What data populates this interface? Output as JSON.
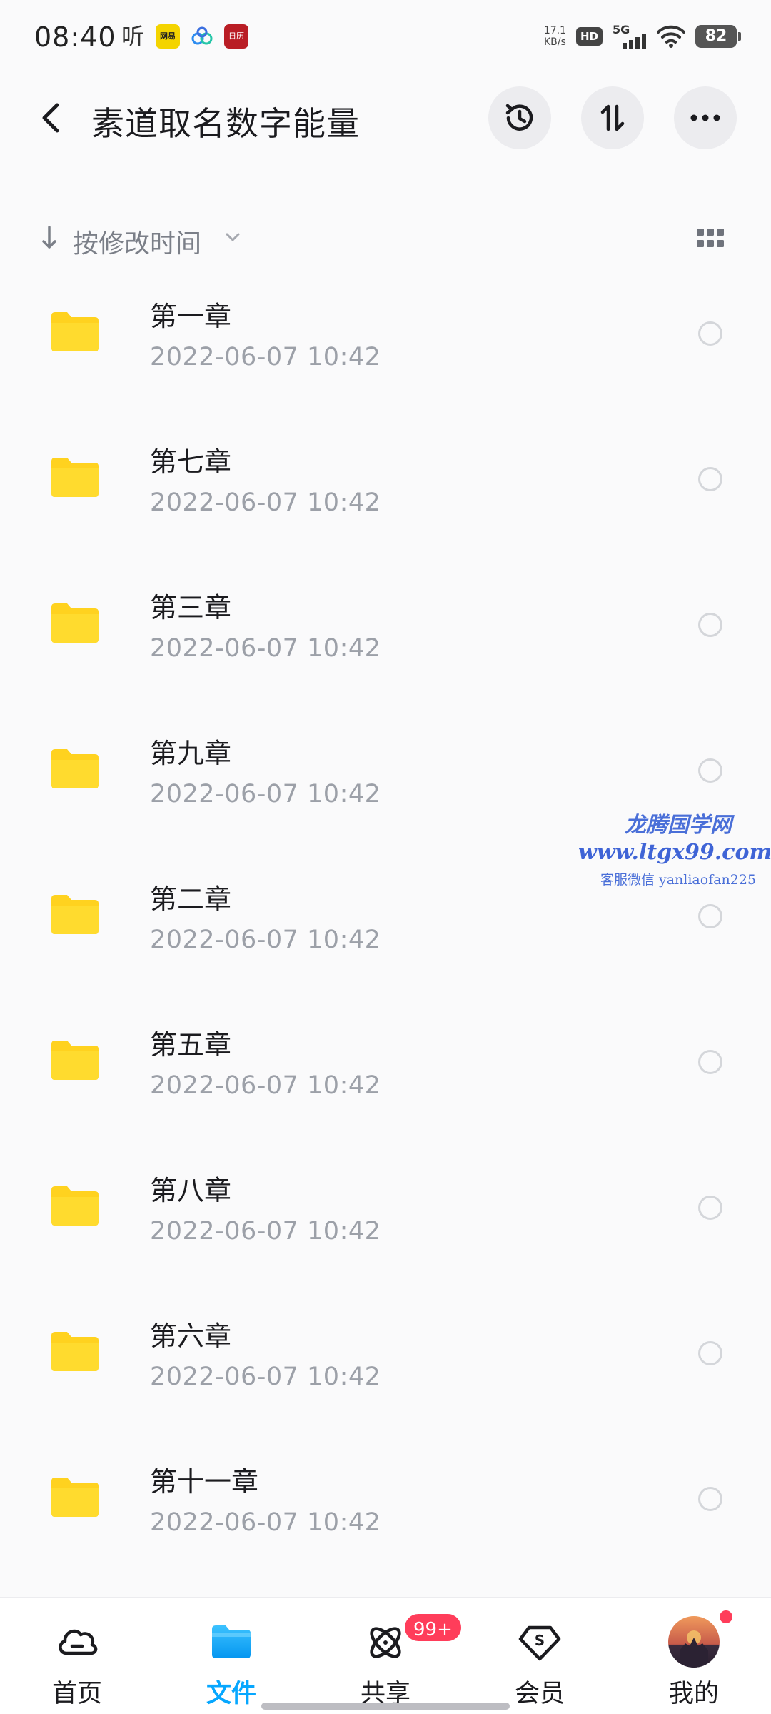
{
  "status_bar": {
    "time": "08:40",
    "app_icons": [
      "听",
      "网易",
      "cloud",
      "日历"
    ],
    "net_speed_value": "17.1",
    "net_speed_unit": "KB/s",
    "hd_label": "HD",
    "network_label": "5G",
    "battery_level": "82"
  },
  "header": {
    "title": "素道取名数字能量"
  },
  "sort": {
    "label": "按修改时间"
  },
  "files": [
    {
      "name": "第一章",
      "date": "2022-06-07  10:42"
    },
    {
      "name": "第七章",
      "date": "2022-06-07  10:42"
    },
    {
      "name": "第三章",
      "date": "2022-06-07  10:42"
    },
    {
      "name": "第九章",
      "date": "2022-06-07  10:42"
    },
    {
      "name": "第二章",
      "date": "2022-06-07  10:42"
    },
    {
      "name": "第五章",
      "date": "2022-06-07  10:42"
    },
    {
      "name": "第八章",
      "date": "2022-06-07  10:42"
    },
    {
      "name": "第六章",
      "date": "2022-06-07  10:42"
    },
    {
      "name": "第十一章",
      "date": "2022-06-07  10:42"
    }
  ],
  "watermark": {
    "title": "龙腾国学网",
    "url": "www.ltgx99.com",
    "contact": "客服微信 yanliaofan225"
  },
  "bottom_nav": {
    "items": [
      {
        "label": "首页",
        "icon": "cloud-home-icon"
      },
      {
        "label": "文件",
        "icon": "folder-icon"
      },
      {
        "label": "共享",
        "icon": "share-orbit-icon"
      },
      {
        "label": "会员",
        "icon": "vip-diamond-icon"
      },
      {
        "label": "我的",
        "icon": "avatar"
      }
    ],
    "share_badge": "99+",
    "active_color": "#06a7ff"
  },
  "colors": {
    "folder": "#ffd21f",
    "accent": "#06a7ff",
    "badge": "#ff3d5a"
  }
}
